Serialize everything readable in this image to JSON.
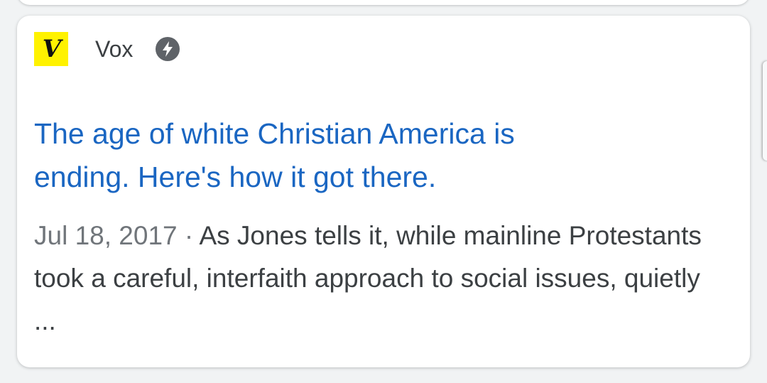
{
  "result": {
    "source": {
      "favicon_letter": "V",
      "favicon_color": "#fff200",
      "name": "Vox",
      "badge_icon": "amp-lightning-icon"
    },
    "headline_line1": "The age of white Christian America is",
    "headline_line2": "ending. Here's how it got there.",
    "snippet": {
      "date": "Jul 18, 2017",
      "separator": "·",
      "text": "As Jones tells it, while mainline Protestants took a careful, interfaith approach to social issues, quietly ..."
    }
  },
  "colors": {
    "link": "#1a66c2",
    "text": "#3c4043",
    "meta": "#70757a",
    "background": "#f1f3f4"
  }
}
